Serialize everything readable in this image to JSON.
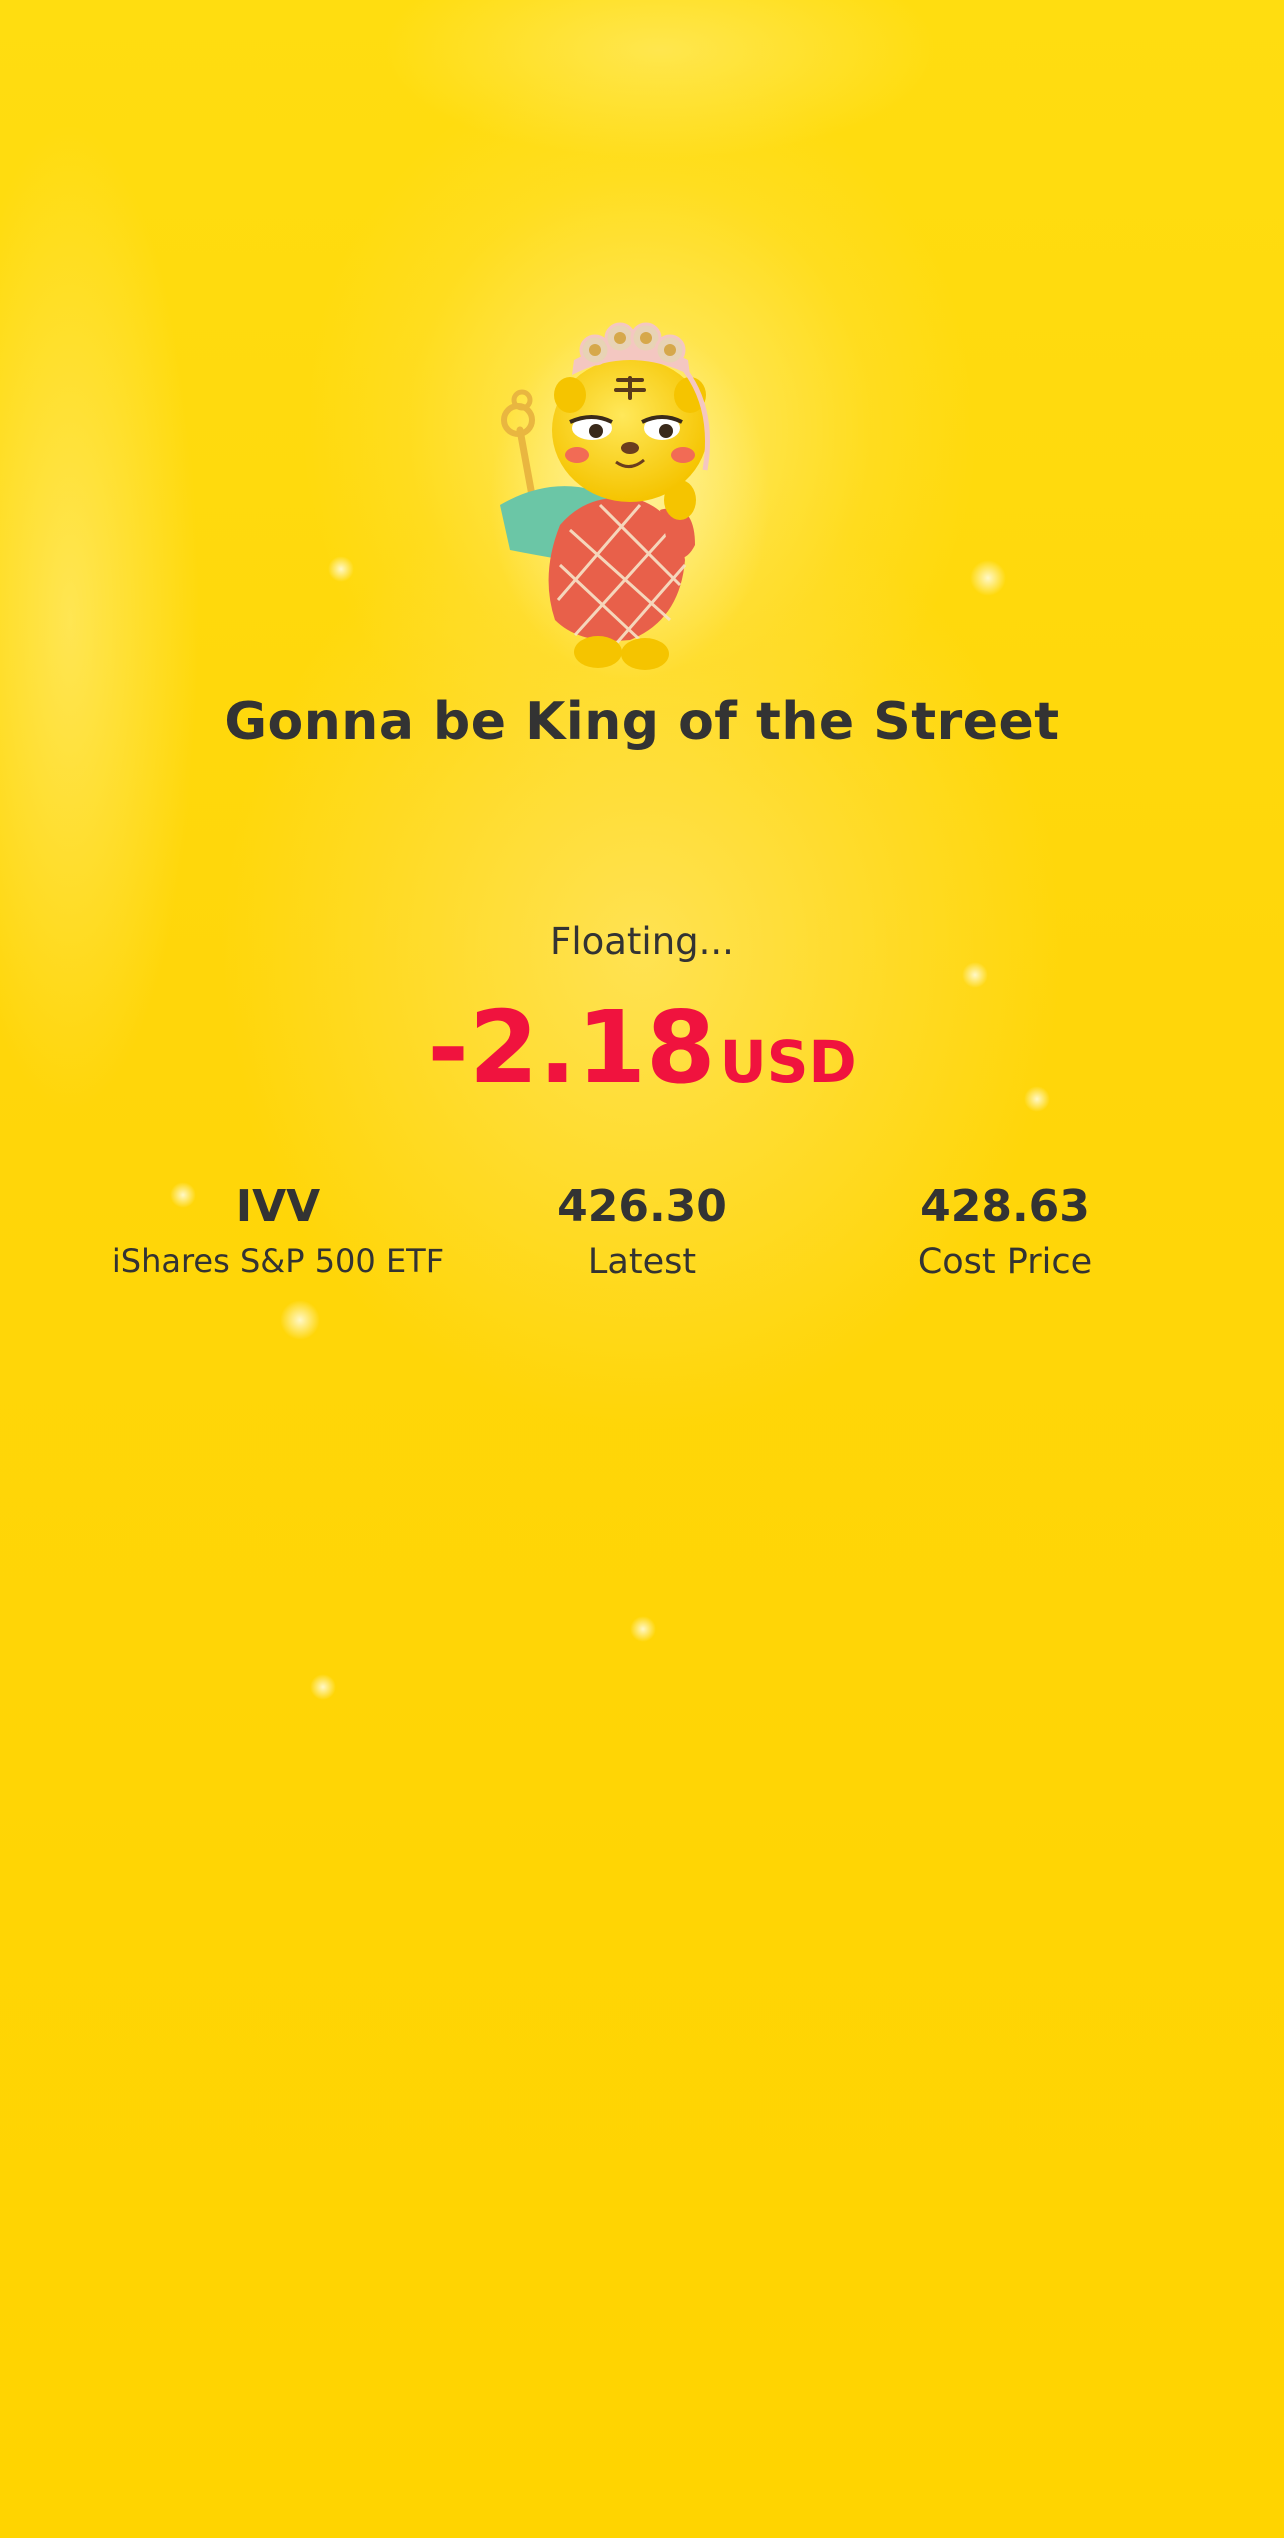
{
  "mascot": {
    "icon": "tiger-king-mascot-icon"
  },
  "header": {
    "title": "Gonna be King of the Street"
  },
  "position": {
    "status_label": "Floating...",
    "pnl_amount": "-2.18",
    "pnl_currency": "USD",
    "pnl_color": "#F0133E"
  },
  "stats": {
    "symbol": "IVV",
    "symbol_name": "iShares S&P 500 ETF",
    "latest_value": "426.30",
    "latest_label": "Latest",
    "cost_value": "428.63",
    "cost_label": "Cost Price"
  },
  "colors": {
    "background": "#FFD800",
    "text": "#333333",
    "negative": "#F0133E"
  }
}
